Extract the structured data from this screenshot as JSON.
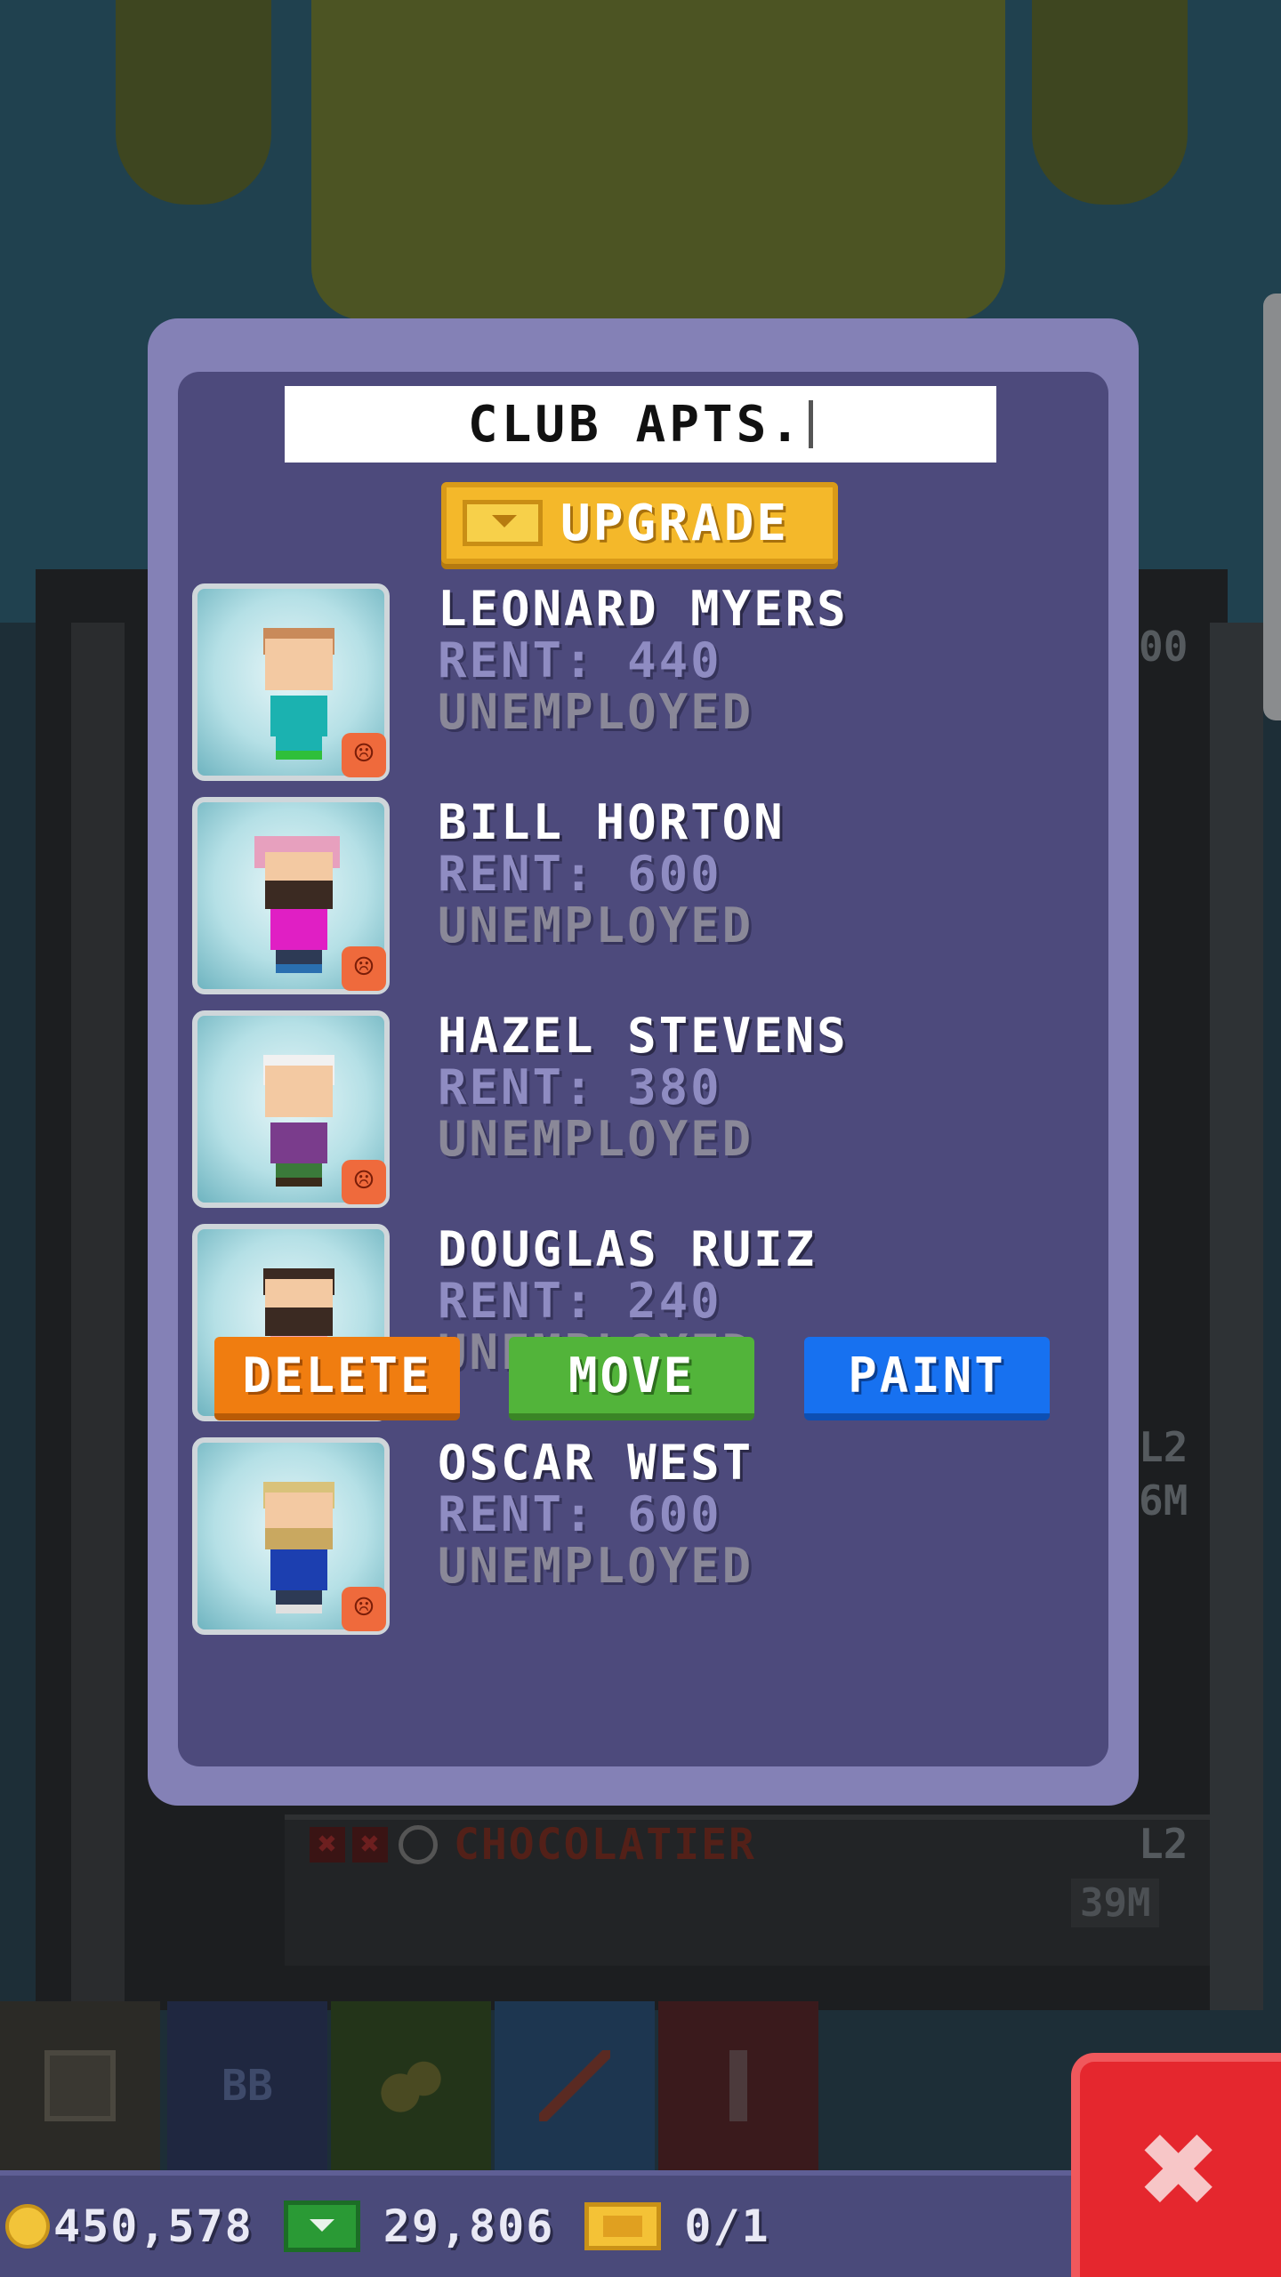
{
  "dialog": {
    "title": "CLUB APTS.",
    "upgrade_label": "UPGRADE",
    "residents": [
      {
        "name": "LEONARD MYERS",
        "rent": "RENT: 440",
        "job": "UNEMPLOYED",
        "mood": "☹"
      },
      {
        "name": "BILL HORTON",
        "rent": "RENT: 600",
        "job": "UNEMPLOYED",
        "mood": "☹"
      },
      {
        "name": "HAZEL STEVENS",
        "rent": "RENT: 380",
        "job": "UNEMPLOYED",
        "mood": "☹"
      },
      {
        "name": "DOUGLAS RUIZ",
        "rent": "RENT: 240",
        "job": "UNEMPLOYED",
        "mood": "☹"
      },
      {
        "name": "OSCAR WEST",
        "rent": "RENT: 600",
        "job": "UNEMPLOYED",
        "mood": "☹"
      }
    ],
    "delete_label": "DELETE",
    "move_label": "MOVE",
    "paint_label": "PAINT"
  },
  "background": {
    "floor_name": "CHOCOLATIER",
    "floor_level": "L2",
    "floor_level_upper": "L2",
    "floor_time": "39M",
    "floor_time_upper": "6M",
    "floor_number_partial": "00",
    "toolbar_tool_2": "BB"
  },
  "status": {
    "coins": "450,578",
    "cash": "29,806",
    "bux": "0/1"
  },
  "close_glyph": "✖",
  "colors": {
    "dialog_frame": "#8481b6",
    "dialog_inner": "#4d4a7c",
    "upgrade": "#f4b82a",
    "delete": "#f07d10",
    "move": "#52b43a",
    "paint": "#1771f0",
    "close": "#e5272e"
  }
}
